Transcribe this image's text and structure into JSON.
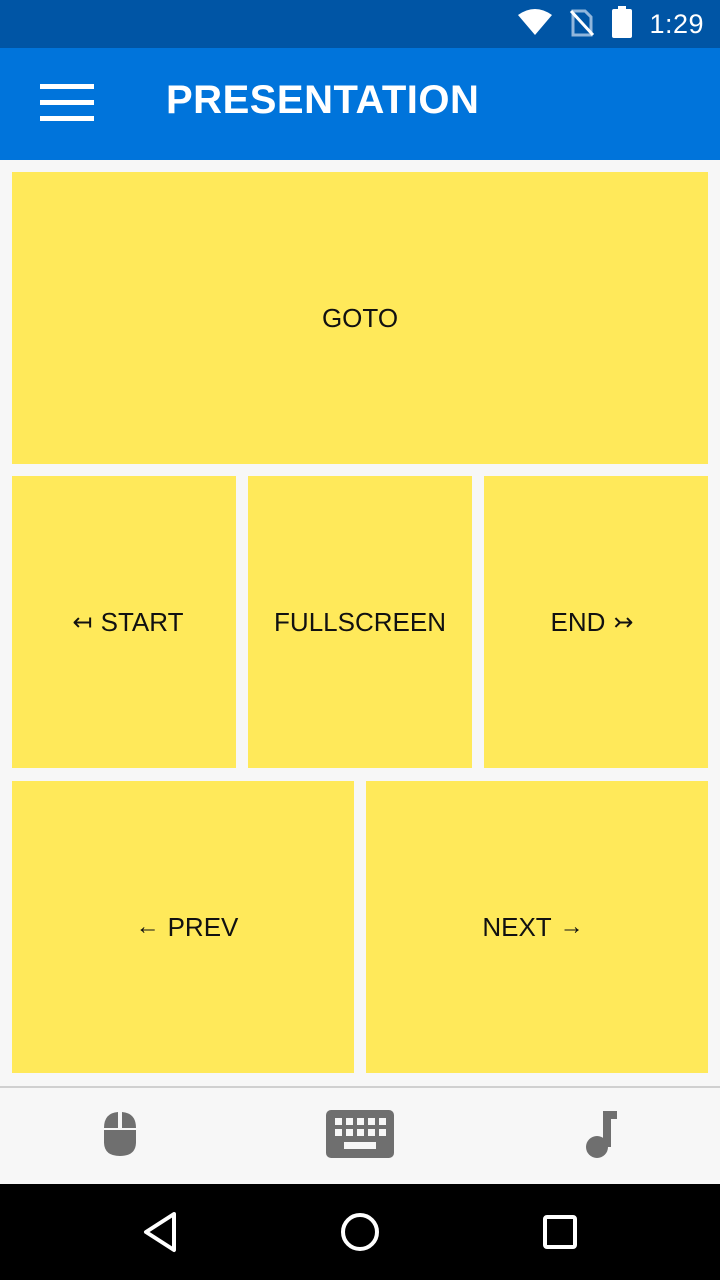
{
  "status_bar": {
    "time": "1:29",
    "icons": [
      "wifi-icon",
      "no-sim-icon",
      "battery-icon"
    ]
  },
  "app_bar": {
    "title": "PRESENTATION",
    "menu_icon": "hamburger-menu-icon"
  },
  "controls": {
    "goto": "GOTO",
    "start": "START",
    "start_arrow": "↤",
    "fullscreen": "FULLSCREEN",
    "end": "END",
    "end_arrow": "↣",
    "prev": "PREV",
    "prev_arrow": "←",
    "next": "NEXT",
    "next_arrow": "→"
  },
  "bottom_nav": {
    "items": [
      {
        "icon": "mouse-icon"
      },
      {
        "icon": "keyboard-icon"
      },
      {
        "icon": "music-note-icon"
      }
    ]
  },
  "system_nav": {
    "items": [
      "back-icon",
      "home-icon",
      "recents-icon"
    ]
  },
  "colors": {
    "status_bar": "#0055a5",
    "app_bar": "#0074db",
    "tile": "#ffe95a",
    "icon_gray": "#6f6f6f"
  }
}
